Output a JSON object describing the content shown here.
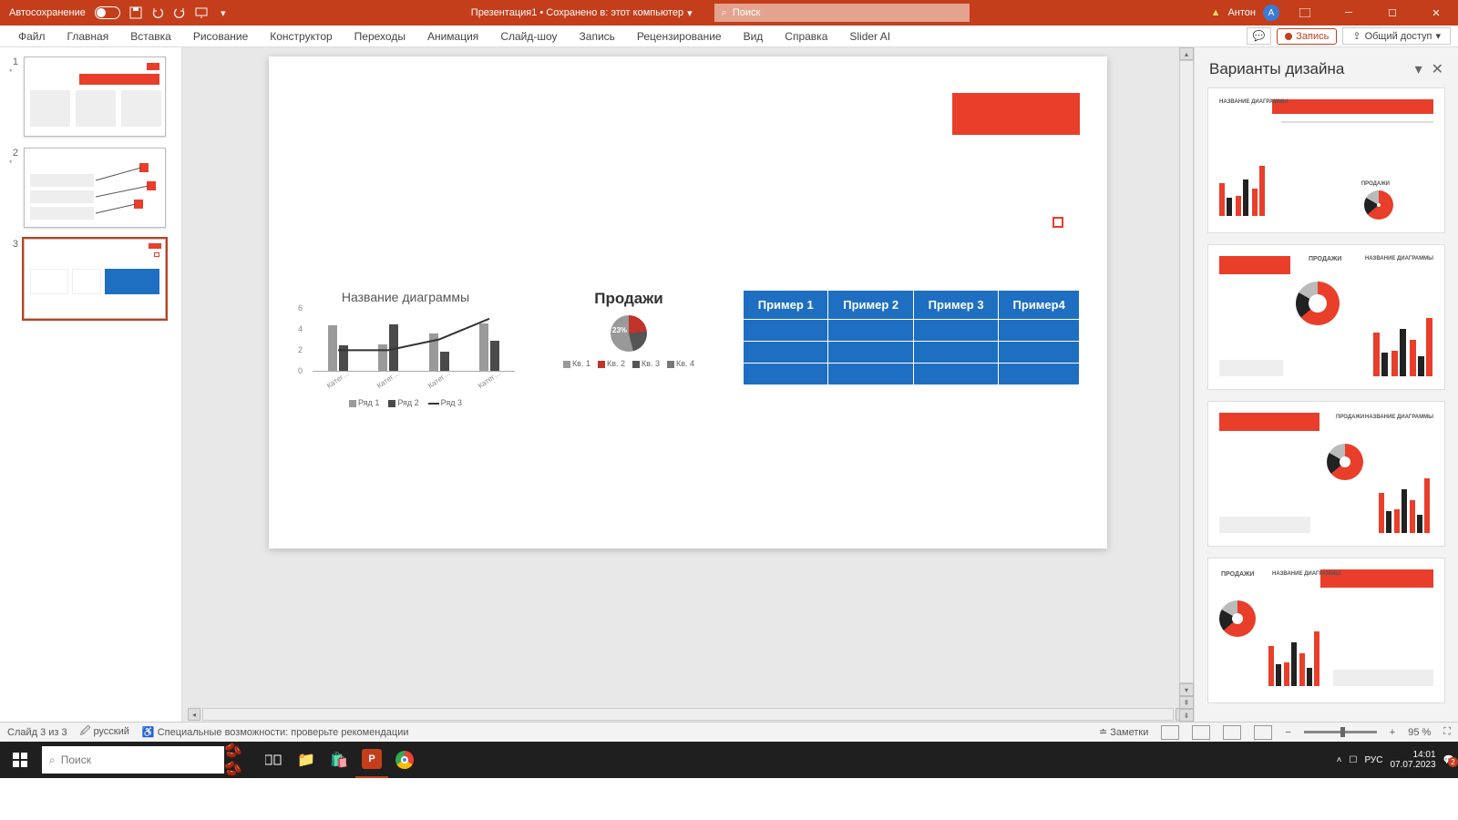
{
  "titlebar": {
    "autosave_label": "Автосохранение",
    "doc_title": "Презентация1 • Сохранено в: этот компьютер",
    "search_placeholder": "Поиск",
    "user_name": "Антон",
    "user_initial": "А"
  },
  "ribbon": {
    "tabs": [
      "Файл",
      "Главная",
      "Вставка",
      "Рисование",
      "Конструктор",
      "Переходы",
      "Анимация",
      "Слайд-шоу",
      "Запись",
      "Рецензирование",
      "Вид",
      "Справка",
      "Slider AI"
    ],
    "record": "Запись",
    "share": "Общий доступ"
  },
  "thumbs": {
    "items": [
      {
        "num": "1",
        "star": "*"
      },
      {
        "num": "2",
        "star": "*"
      },
      {
        "num": "3",
        "star": ""
      }
    ]
  },
  "slide": {
    "barchart_title": "Название диаграммы",
    "pie_title": "Продажи",
    "pie_label": "23%",
    "table_headers": [
      "Пример 1",
      "Пример 2",
      "Пример 3",
      "Пример4"
    ],
    "bar_legend": [
      "Ряд 1",
      "Ряд 2",
      "Ряд 3"
    ],
    "pie_legend": [
      "Кв. 1",
      "Кв. 2",
      "Кв. 3",
      "Кв. 4"
    ]
  },
  "chart_data": [
    {
      "type": "bar",
      "title": "Название диаграммы",
      "categories": [
        "Катег…",
        "Катег…",
        "Катег…",
        "Катег…"
      ],
      "series": [
        {
          "name": "Ряд 1",
          "values": [
            4.3,
            2.5,
            3.5,
            4.5
          ],
          "color": "#9a9a9a"
        },
        {
          "name": "Ряд 2",
          "values": [
            2.4,
            4.4,
            1.8,
            2.8
          ],
          "color": "#4a4a4a"
        }
      ],
      "line_series": {
        "name": "Ряд 3",
        "values": [
          2,
          2,
          3,
          5
        ],
        "color": "#333"
      },
      "yticks": [
        0,
        2,
        4,
        6
      ],
      "ylim": [
        0,
        6
      ]
    },
    {
      "type": "pie",
      "title": "Продажи",
      "labels": [
        "Кв. 1",
        "Кв. 2",
        "Кв. 3",
        "Кв. 4"
      ],
      "values": [
        23,
        23,
        27,
        27
      ],
      "colors": [
        "#999",
        "#c0342a",
        "#555",
        "#777"
      ]
    },
    {
      "type": "table",
      "headers": [
        "Пример 1",
        "Пример 2",
        "Пример 3",
        "Пример4"
      ],
      "rows": 3
    }
  ],
  "design_pane": {
    "title": "Варианты дизайна"
  },
  "statusbar": {
    "slide_info": "Слайд 3 из 3",
    "language": "русский",
    "accessibility": "Специальные возможности: проверьте рекомендации",
    "notes": "Заметки",
    "zoom": "95 %"
  },
  "taskbar": {
    "search_placeholder": "Поиск",
    "lang": "РУС",
    "time": "14:01",
    "date": "07.07.2023"
  }
}
